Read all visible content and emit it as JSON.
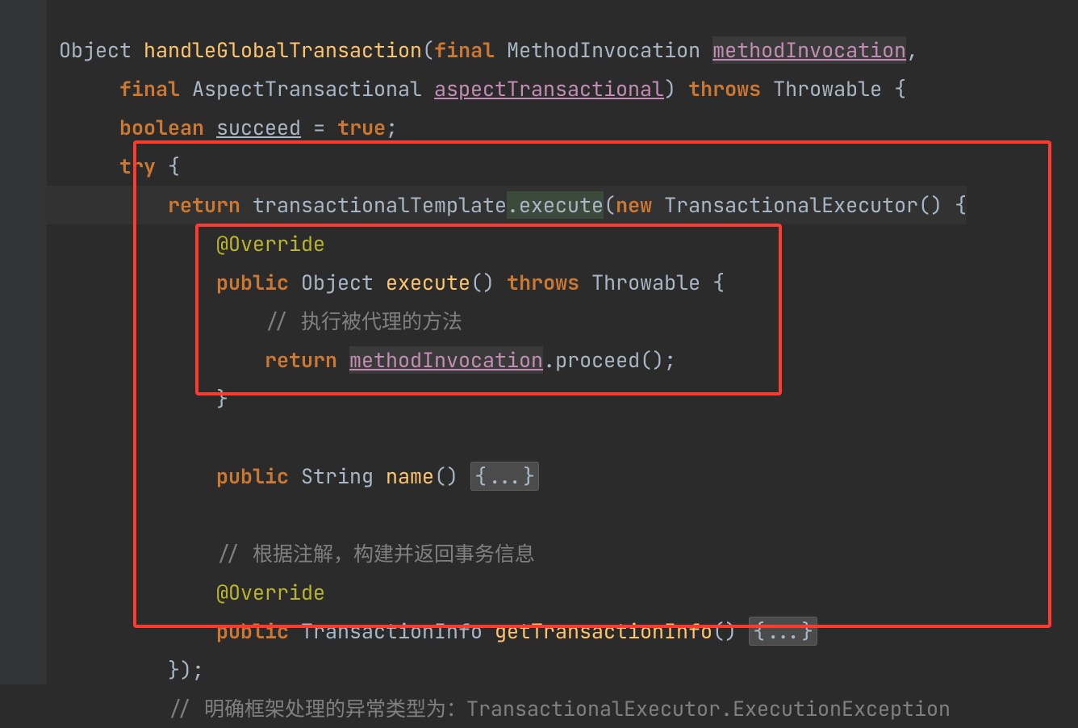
{
  "keywords": {
    "final": "final",
    "throws": "throws",
    "boolean": "boolean",
    "true_lit": "true",
    "try": "try",
    "return": "return",
    "new": "new",
    "public": "public"
  },
  "lines": {
    "l1_object": "Object ",
    "l1_method": "handleGlobalTransaction",
    "l1_paren": "(",
    "l1_type1": " MethodInvocation ",
    "l1_arg1": "methodInvocation",
    "l1_end": ",",
    "l2_type": " AspectTransactional ",
    "l2_arg": "aspectTransactional",
    "l2_paren": ") ",
    "l2_throwable": " Throwable {",
    "l3_succeed": "succeed",
    "l3_eq": " = ",
    "l3_semi": ";",
    "l4_brace": " {",
    "l5_tmpl": " transactionalTemplate",
    "l5_exec": ".execute",
    "l5_paren": "(",
    "l5_type": " TransactionalExecutor() {",
    "l6_override": "@Override",
    "l7_sig1": " Object ",
    "l7_exec": "execute",
    "l7_sig2": "() ",
    "l7_throwable": " Throwable {",
    "l8_comment": "// 执行被代理的方法",
    "l9_return_sp": " ",
    "l9_var": "methodInvocation",
    "l9_proceed": ".proceed();",
    "l10_brace": "}",
    "l11_sig1": " String ",
    "l11_name": "name",
    "l11_sig2": "() ",
    "l11_fold": "{...}",
    "l12_comment": "// 根据注解，构建并返回事务信息",
    "l13_override": "@Override",
    "l14_sig1": " TransactionInfo ",
    "l14_getti": "getTransactionInfo",
    "l14_sig2": "() ",
    "l14_fold": "{...}",
    "l15_close": "});",
    "l16_comment": "// 明确框架处理的异常类型为：TransactionalExecutor.ExecutionException"
  },
  "icons": {
    "bulb": "lightbulb-icon"
  },
  "colors": {
    "bg": "#2b2b2b",
    "gutter": "#313335",
    "keyword": "#cc7832",
    "method": "#ffc66d",
    "annotation": "#bbb529",
    "comment": "#808080",
    "variable": "#c38db5",
    "fold_bg": "#4b4b4b",
    "highlight_box": "#ff3b30"
  }
}
